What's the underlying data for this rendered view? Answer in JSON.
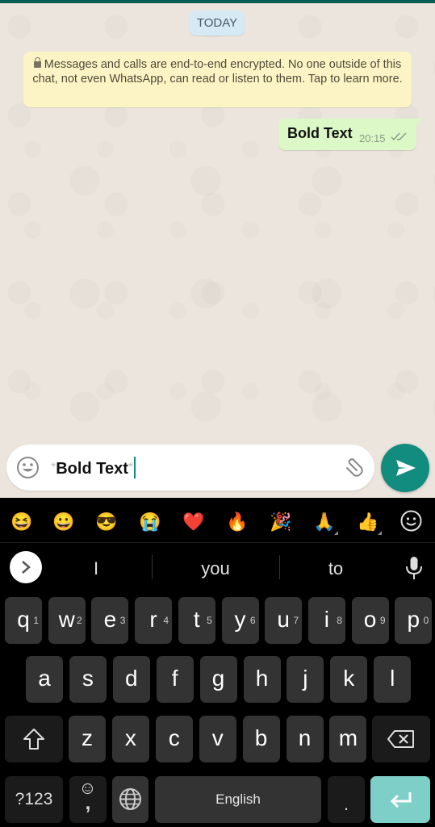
{
  "chat": {
    "date_label": "TODAY",
    "encryption_notice": "Messages and calls are end-to-end encrypted. No one outside of this chat, not even WhatsApp, can read or listen to them. Tap to learn more.",
    "messages": [
      {
        "text": "Bold Text",
        "time": "20:15",
        "direction": "outgoing",
        "status": "delivered"
      }
    ]
  },
  "composer": {
    "value_prefix": "*",
    "value_body": "Bold Text",
    "value_suffix": "*",
    "emoji_icon": "smiley-icon",
    "attach_icon": "paperclip-icon",
    "send_icon": "send-icon"
  },
  "colors": {
    "brand_dark": "#075e54",
    "accent": "#128c7e",
    "outgoing_bubble": "#dcf8c6",
    "enter_key": "#7ecfc7"
  },
  "keyboard": {
    "emoji_suggestions": [
      "😆",
      "😀",
      "😎",
      "😭",
      "❤️",
      "🔥",
      "🎉",
      "🙏",
      "👍"
    ],
    "word_suggestions": [
      "I",
      "you",
      "to"
    ],
    "row1": [
      {
        "k": "q",
        "n": "1"
      },
      {
        "k": "w",
        "n": "2"
      },
      {
        "k": "e",
        "n": "3"
      },
      {
        "k": "r",
        "n": "4"
      },
      {
        "k": "t",
        "n": "5"
      },
      {
        "k": "y",
        "n": "6"
      },
      {
        "k": "u",
        "n": "7"
      },
      {
        "k": "i",
        "n": "8"
      },
      {
        "k": "o",
        "n": "9"
      },
      {
        "k": "p",
        "n": "0"
      }
    ],
    "row2": [
      "a",
      "s",
      "d",
      "f",
      "g",
      "h",
      "j",
      "k",
      "l"
    ],
    "row3": [
      "z",
      "x",
      "c",
      "v",
      "b",
      "n",
      "m"
    ],
    "symbols_label": "?123",
    "comma_label": ",",
    "space_label": "English",
    "period_label": "."
  }
}
